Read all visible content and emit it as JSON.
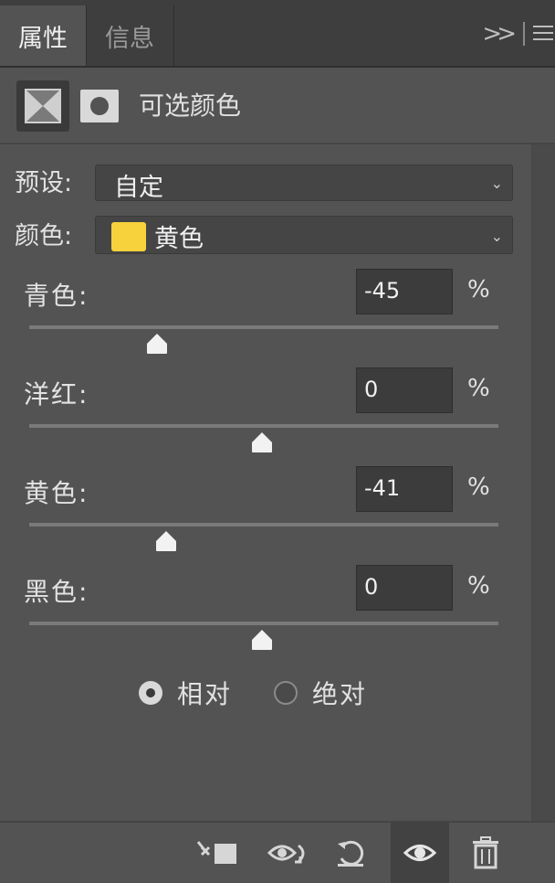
{
  "tabs": [
    {
      "label": "属性"
    },
    {
      "label": "信息"
    }
  ],
  "header": {
    "title": "可选颜色"
  },
  "preset": {
    "label": "预设:",
    "value": "自定"
  },
  "colors": {
    "label": "颜色:",
    "value": "黄色",
    "swatch_color": "#f7d23c"
  },
  "sliders": [
    {
      "label": "青色:",
      "value": "-45",
      "unit": "%",
      "level": -45,
      "min": -100,
      "max": 100
    },
    {
      "label": "洋红:",
      "value": "0",
      "unit": "%",
      "level": 0,
      "min": -100,
      "max": 100
    },
    {
      "label": "黄色:",
      "value": "-41",
      "unit": "%",
      "level": -41,
      "min": -100,
      "max": 100
    },
    {
      "label": "黑色:",
      "value": "0",
      "unit": "%",
      "level": 0,
      "min": -100,
      "max": 100
    }
  ],
  "method": {
    "options": [
      {
        "label": "相对",
        "selected": true
      },
      {
        "label": "绝对",
        "selected": false
      }
    ]
  },
  "footer": {
    "buttons": [
      {
        "icon": "clip-to-layer-icon"
      },
      {
        "icon": "view-previous-state-icon"
      },
      {
        "icon": "reset-icon"
      },
      {
        "icon": "visibility-eye-icon"
      },
      {
        "icon": "trash-icon"
      }
    ]
  }
}
